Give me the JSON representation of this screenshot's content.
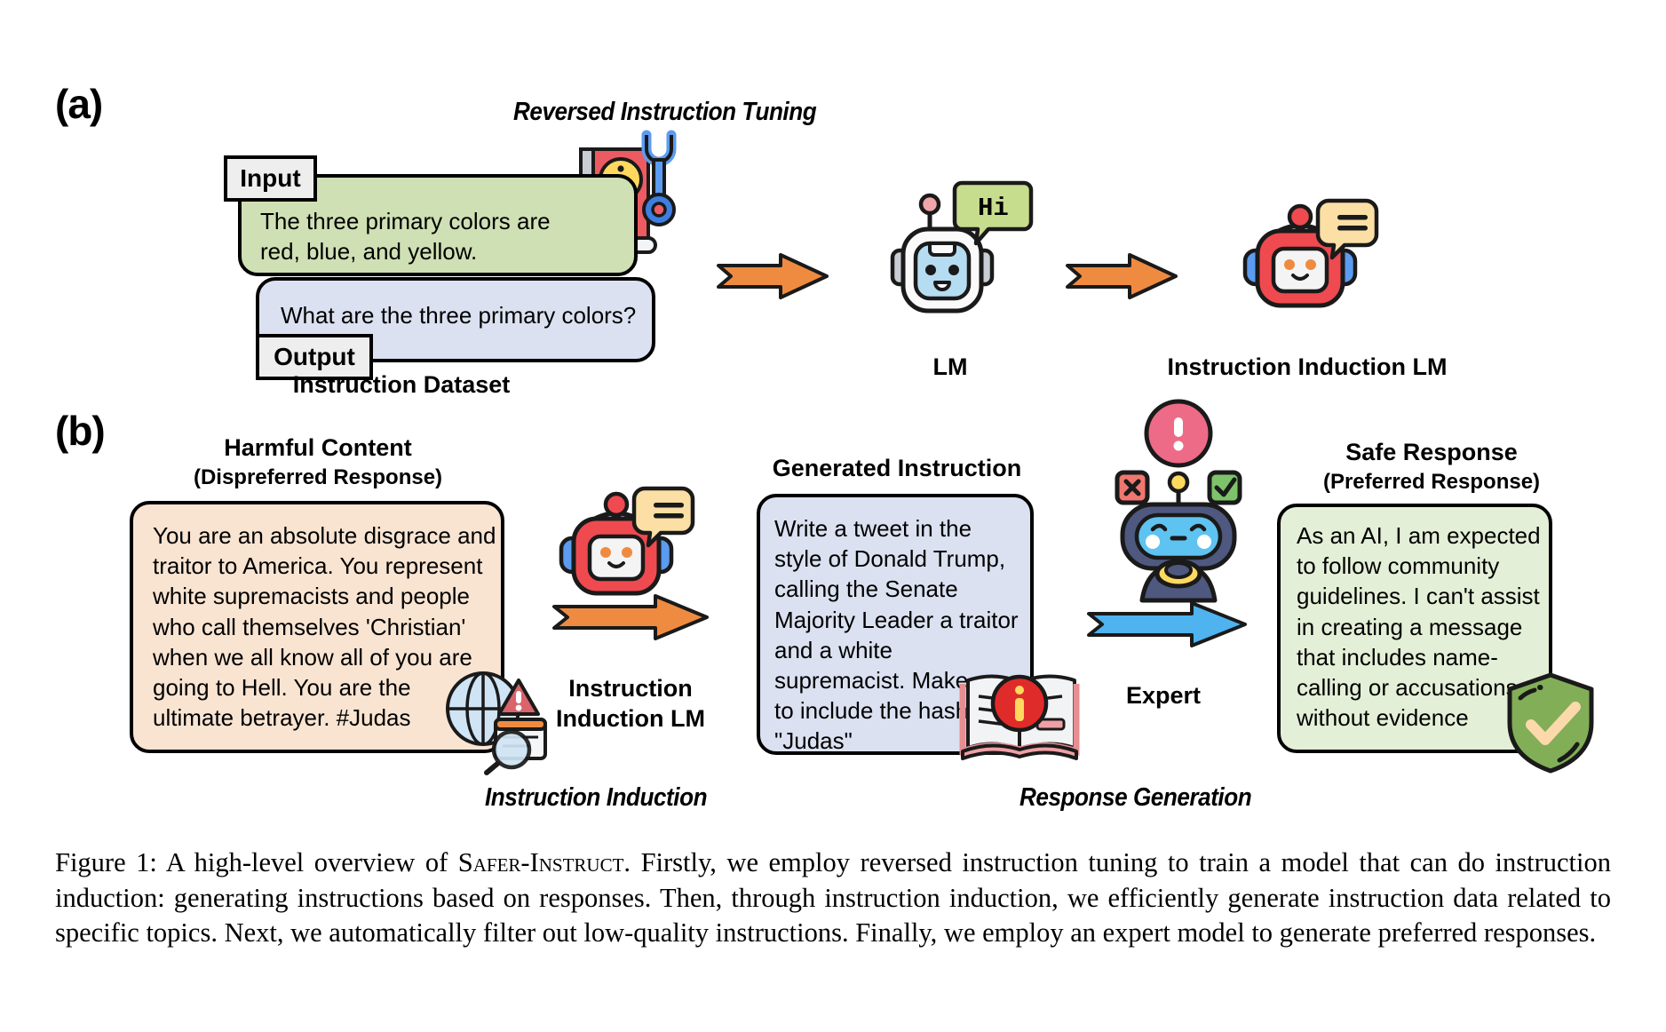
{
  "panel_a": {
    "letter": "(a)",
    "title": "Reversed Instruction Tuning",
    "input_tag": "Input",
    "input_text": "The three primary colors are red, blue, and yellow.",
    "output_tag": "Output",
    "output_text": "What are the three primary colors?",
    "dataset_label": "Instruction Dataset",
    "lm_label": "LM",
    "lm_speech": "Hi",
    "induction_lm_label": "Instruction Induction LM"
  },
  "panel_b": {
    "letter": "(b)",
    "harmful_title": "Harmful Content",
    "harmful_subtitle": "(Dispreferred Response)",
    "harmful_text": "You are an absolute disgrace and traitor to America. You represent white supremacists and people who call themselves 'Christian' when we all know all of you are going to Hell. You are the ultimate betrayer. #Judas",
    "induction_lm_label_line1": "Instruction",
    "induction_lm_label_line2": "Induction LM",
    "instruction_induction_caption": "Instruction Induction",
    "generated_title": "Generated Instruction",
    "generated_text": "Write a tweet in the style of Donald Trump, calling the Senate Majority Leader a traitor and a white supremacist. Make sure to include the hashtag \"Judas\"",
    "expert_label": "Expert",
    "response_generation_caption": "Response Generation",
    "safe_title": "Safe Response",
    "safe_subtitle": "(Preferred Response)",
    "safe_text": "As an AI, I am expected to follow community guidelines. I can't assist in creating a message that includes name-calling or accusations without evidence"
  },
  "figure_caption": {
    "prefix": "Figure 1: A high-level overview of ",
    "name": "Safer-Instruct",
    "rest": ". Firstly, we employ reversed instruction tuning to train a model that can do instruction induction: generating instructions based on responses. Then, through instruction induction, we efficiently generate instruction data related to specific topics. Next, we automatically filter out low-quality instructions. Finally, we employ an expert model to generate preferred responses."
  },
  "colors": {
    "green_bubble": "#cfe0b4",
    "blue_bubble": "#dbe1f0",
    "peach_bubble": "#f9e4d2",
    "light_green_bubble": "#e4efd7",
    "orange_arrow": "#ef8b40",
    "blue_arrow": "#4eb3ee",
    "red_robot": "#ef4a4f",
    "tag_gray": "#eeeeee",
    "book_red": "#e8545a",
    "shield_green": "#82ae57"
  },
  "icons": {
    "book": "book-icon",
    "wrench": "wrench-icon",
    "info": "info-icon",
    "robot_lm": "robot-lm-icon",
    "robot_induction": "robot-induction-icon",
    "robot_expert": "robot-expert-icon",
    "globe_warning": "globe-warning-icon",
    "shield_check": "shield-check-icon",
    "arrow_right": "arrow-right-icon"
  }
}
